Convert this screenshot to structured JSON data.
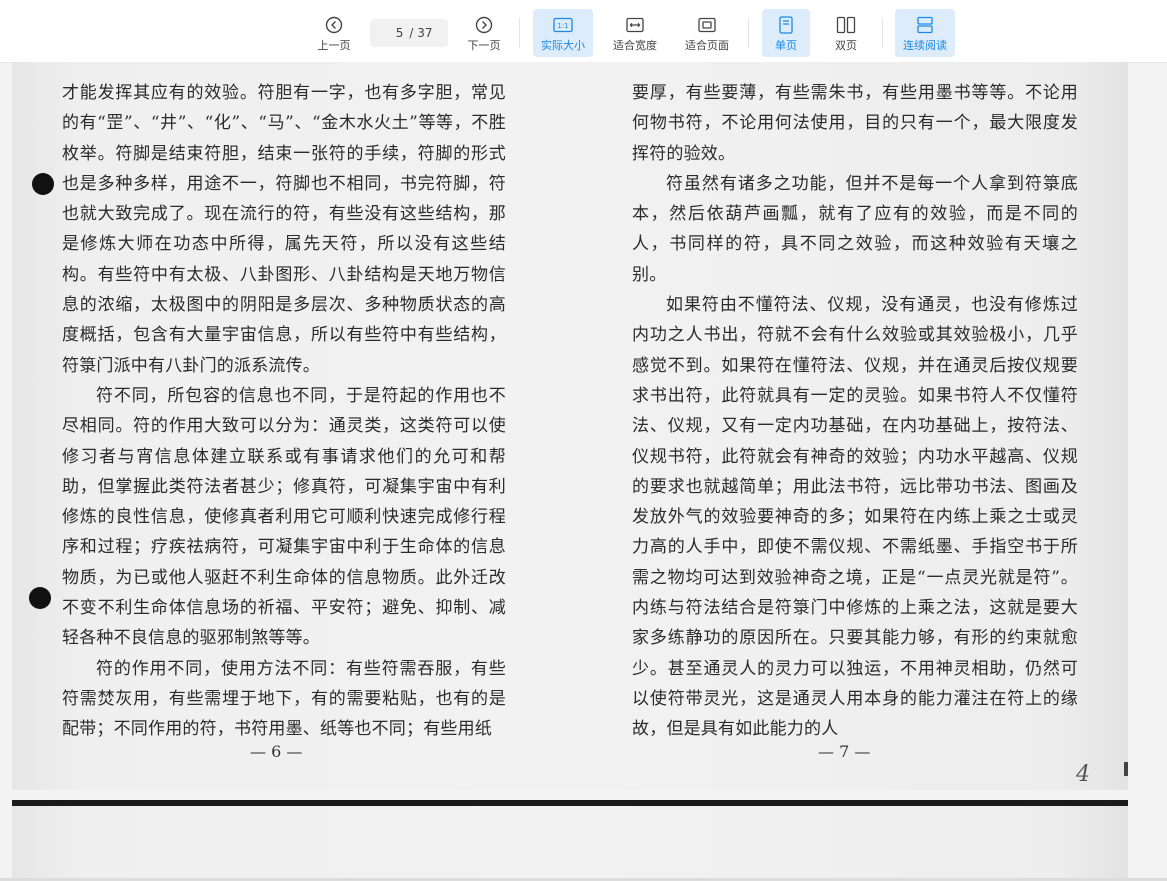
{
  "toolbar": {
    "prev_label": "上一页",
    "next_label": "下一页",
    "current_page": "5",
    "total_pages": "/ 37",
    "actual_size_label": "实际大小",
    "fit_width_label": "适合宽度",
    "fit_page_label": "适合页面",
    "single_label": "单页",
    "double_label": "双页",
    "continuous_label": "连续阅读",
    "actual_size_icon_text": "1:1",
    "active_color": "#1e88e5"
  },
  "document": {
    "left_paragraphs": [
      "才能发挥其应有的效验。符胆有一字，也有多字胆，常见的有“罡”、“井”、“化”、“马”、“金木水火土”等等，不胜枚举。符脚是结束符胆，结束一张符的手续，符脚的形式也是多种多样，用途不一，符脚也不相同，书完符脚，符也就大致完成了。现在流行的符，有些没有这些结构，那是修炼大师在功态中所得，属先天符，所以没有这些结构。有些符中有太极、八卦图形、八卦结构是天地万物信息的浓缩，太极图中的阴阳是多层次、多种物质状态的高度概括，包含有大量宇宙信息，所以有些符中有些结构，符箓门派中有八卦门的派系流传。",
      "符不同，所包容的信息也不同，于是符起的作用也不尽相同。符的作用大致可以分为：通灵类，这类符可以使修习者与宵信息体建立联系或有事请求他们的允可和帮助，但掌握此类符法者甚少；修真符，可凝集宇宙中有利修炼的良性信息，使修真者利用它可顺利快速完成修行程序和过程；疗疾祛病符，可凝集宇宙中利于生命体的信息物质，为已或他人驱赶不利生命体的信息物质。此外迁改不变不利生命体信息场的祈福、平安符；避免、抑制、减轻各种不良信息的驱邪制煞等等。",
      "符的作用不同，使用方法不同：有些符需吞服，有些符需焚灰用，有些需埋于地下，有的需要粘贴，也有的是配带；不同作用的符，书符用墨、纸等也不同；有些用纸"
    ],
    "right_paragraphs": [
      "要厚，有些要薄，有些需朱书，有些用墨书等等。不论用何物书符，不论用何法使用，目的只有一个，最大限度发挥符的验效。",
      "符虽然有诸多之功能，但并不是每一个人拿到符箓底本，然后依葫芦画瓢，就有了应有的效验，而是不同的人，书同样的符，具不同之效验，而这种效验有天壤之别。",
      "如果符由不懂符法、仪规，没有通灵，也没有修炼过内功之人书出，符就不会有什么效验或其效验极小，几乎感觉不到。如果符在懂符法、仪规，并在通灵后按仪规要求书出符，此符就具有一定的灵验。如果书符人不仅懂符法、仪规，又有一定内功基础，在内功基础上，按符法、仪规书符，此符就会有神奇的效验；内功水平越高、仪规的要求也就越简单；用此法书符，远比带功书法、图画及发放外气的效验要神奇的多；如果符在内练上乘之士或灵力高的人手中，即使不需仪规、不需纸墨、手指空书于所需之物均可达到效验神奇之境，正是“一点灵光就是符”。内练与符法结合是符箓门中修炼的上乘之法，这就是要大家多练静功的原因所在。只要其能力够，有形的约束就愈少。甚至通灵人的灵力可以独运，不用神灵相助，仍然可以使符带灵光，这是通灵人用本身的能力灌注在符上的缘故，但是具有如此能力的人"
    ],
    "left_page_number": "— 6 —",
    "right_page_number": "— 7 —",
    "handwritten_number": "4",
    "next_page_peek": "……………………"
  }
}
